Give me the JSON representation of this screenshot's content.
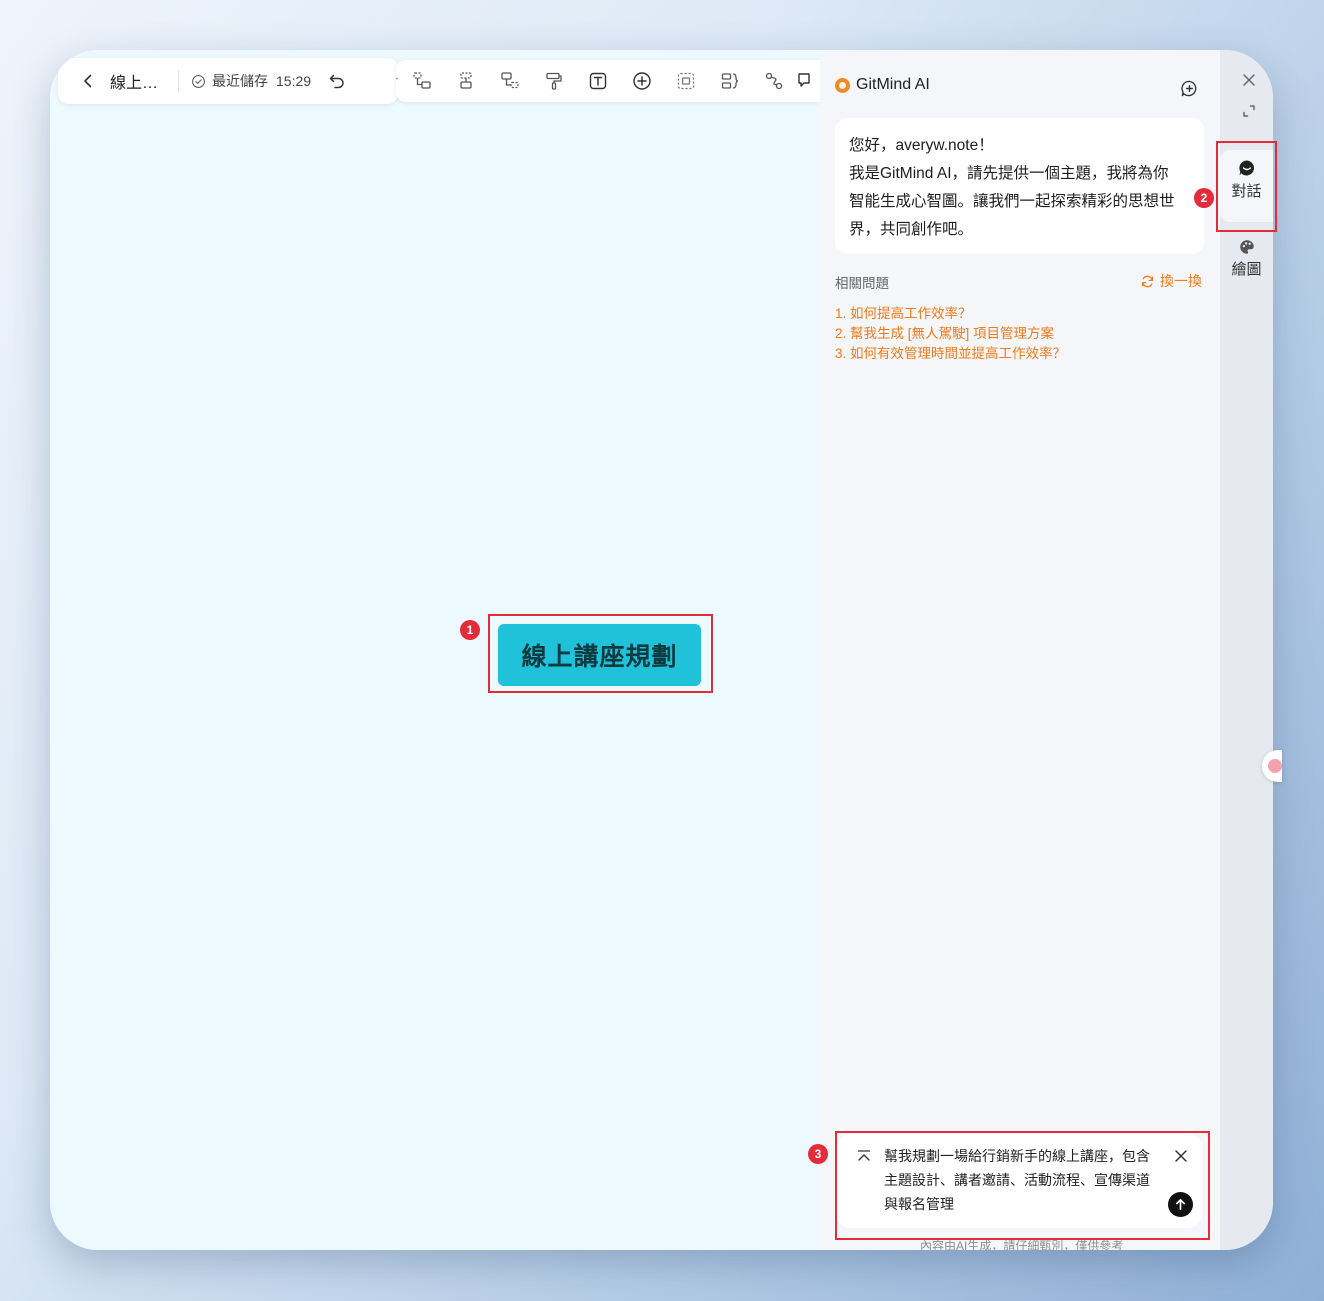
{
  "doc": {
    "title": "線上…",
    "save_label": "最近儲存",
    "save_time": "15:29"
  },
  "toolbar": {
    "tools": [
      "add-child-icon",
      "add-sibling-icon",
      "add-parent-icon",
      "format-painter-icon",
      "text-icon",
      "insert-icon",
      "group-icon",
      "summary-icon",
      "relation-icon",
      "comment-icon"
    ]
  },
  "canvas": {
    "root_node": "線上講座規劃"
  },
  "badges": [
    "1",
    "2",
    "3"
  ],
  "ai": {
    "title": "GitMind AI",
    "greeting": [
      "您好，averyw.note！",
      "我是GitMind AI，請先提供一個主題，我將為你",
      "智能生成心智圖。讓我們一起探索精彩的思想世",
      "界，共同創作吧。"
    ],
    "related_label": "相關問題",
    "refresh_label": "換一換",
    "suggestions": [
      "1. 如何提高工作效率？",
      "2. 幫我生成 [無人駕駛] 項目管理方案",
      "3. 如何有效管理時間並提高工作效率？"
    ],
    "input_lines": [
      "幫我規劃一場給行銷新手的線上講座，包含",
      "主題設計、講者邀請、活動流程、宣傳渠道",
      "與報名管理"
    ],
    "disclaimer": "內容由AI生成，請仔細甄別，僅供參考"
  },
  "rail": {
    "tabs": [
      {
        "label": "對話",
        "icon": "chat-icon",
        "active": true
      },
      {
        "label": "繪圖",
        "icon": "palette-icon",
        "active": false
      }
    ]
  },
  "colors": {
    "accent": "#f07a1a",
    "node": "#1fc2d8",
    "highlight": "#e32b39",
    "canvas": "#ecf9ff"
  }
}
